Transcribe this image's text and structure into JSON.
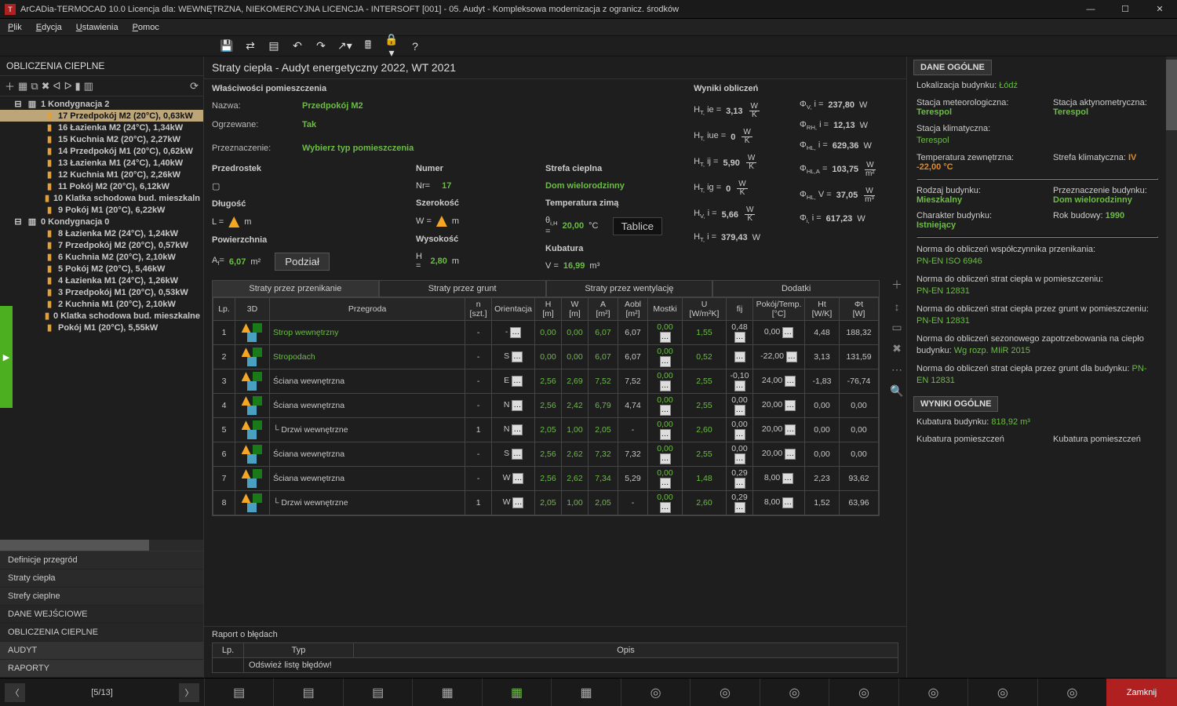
{
  "titlebar": "ArCADia-TERMOCAD 10.0 Licencja dla: WEWNĘTRZNA, NIEKOMERCYJNA LICENCJA - INTERSOFT [001] - 05. Audyt - Kompleksowa modernizacja z ogranicz. środków",
  "menus": [
    "Plik",
    "Edycja",
    "Ustawienia",
    "Pomoc"
  ],
  "left_header": "OBLICZENIA CIEPLNE",
  "tree": [
    {
      "lvl": 1,
      "sel": false,
      "label": "1 Kondygnacja 2"
    },
    {
      "lvl": 2,
      "sel": true,
      "label": "17 Przedpokój M2 (20°C), 0,63kW"
    },
    {
      "lvl": 2,
      "sel": false,
      "label": "16 Łazienka M2 (24°C), 1,34kW"
    },
    {
      "lvl": 2,
      "sel": false,
      "label": "15 Kuchnia M2 (20°C), 2,27kW"
    },
    {
      "lvl": 2,
      "sel": false,
      "label": "14 Przedpokój M1 (20°C), 0,62kW"
    },
    {
      "lvl": 2,
      "sel": false,
      "label": "13 Łazienka M1 (24°C), 1,40kW"
    },
    {
      "lvl": 2,
      "sel": false,
      "label": "12 Kuchnia M1 (20°C), 2,26kW"
    },
    {
      "lvl": 2,
      "sel": false,
      "label": "11 Pokój M2 (20°C), 6,12kW"
    },
    {
      "lvl": 2,
      "sel": false,
      "label": "10 Klatka schodowa bud. mieszkaln"
    },
    {
      "lvl": 2,
      "sel": false,
      "label": "9 Pokój M1 (20°C), 6,22kW"
    },
    {
      "lvl": 1,
      "sel": false,
      "label": "0 Kondygnacja 0"
    },
    {
      "lvl": 2,
      "sel": false,
      "label": "8 Łazienka M2 (24°C), 1,24kW"
    },
    {
      "lvl": 2,
      "sel": false,
      "label": "7 Przedpokój M2 (20°C), 0,57kW"
    },
    {
      "lvl": 2,
      "sel": false,
      "label": "6 Kuchnia M2 (20°C), 2,10kW"
    },
    {
      "lvl": 2,
      "sel": false,
      "label": "5 Pokój M2 (20°C), 5,46kW"
    },
    {
      "lvl": 2,
      "sel": false,
      "label": "4 Łazienka M1 (24°C), 1,26kW"
    },
    {
      "lvl": 2,
      "sel": false,
      "label": "3 Przedpokój M1 (20°C), 0,53kW"
    },
    {
      "lvl": 2,
      "sel": false,
      "label": "2 Kuchnia M1 (20°C), 2,10kW"
    },
    {
      "lvl": 2,
      "sel": false,
      "label": "0 Klatka schodowa bud. mieszkalne"
    },
    {
      "lvl": 2,
      "sel": false,
      "label": "Pokój M1 (20°C), 5,55kW"
    }
  ],
  "side_items": [
    {
      "cls": "light",
      "t": "Definicje przegród"
    },
    {
      "cls": "light",
      "t": "Straty ciepła"
    },
    {
      "cls": "light",
      "t": "Strefy cieplne"
    },
    {
      "cls": "dark",
      "t": "DANE WEJŚCIOWE"
    },
    {
      "cls": "dark",
      "t": "OBLICZENIA CIEPLNE"
    },
    {
      "cls": "",
      "t": "AUDYT"
    },
    {
      "cls": "",
      "t": "RAPORTY"
    }
  ],
  "center_title": "Straty ciepła - Audyt energetyczny 2022, WT 2021",
  "props_header": "Właściwości pomieszczenia",
  "form": {
    "nazwa_l": "Nazwa:",
    "nazwa_v": "Przedpokój M2",
    "ogrz_l": "Ogrzewane:",
    "ogrz_v": "Tak",
    "przez_l": "Przeznaczenie:",
    "przez_v": "Wybierz typ pomieszczenia",
    "przed_l": "Przedrostek",
    "numer_l": "Numer",
    "numer_pre": "Nr=",
    "numer_v": "17",
    "strefa_l": "Strefa cieplna",
    "strefa_v": "Dom wielorodzinny",
    "dlug_l": "Długość",
    "dlug_v": "L =",
    "dlug_u": "m",
    "szer_l": "Szerokość",
    "szer_v": "W =",
    "szer_u": "m",
    "temp_l": "Temperatura zimą",
    "temp_sym": "θ",
    "temp_sub": "i,H",
    "temp_eq": "=",
    "temp_v": "20,00",
    "temp_u": "°C",
    "tablice": "Tablice",
    "pow_l": "Powierzchnia",
    "pow_sym": "A",
    "pow_sub": "f",
    "pow_eq": "=",
    "pow_v": "6,07",
    "pow_u": "m²",
    "podzial": "Podział",
    "wys_l": "Wysokość",
    "wys_sym": "H =",
    "wys_v": "2,80",
    "wys_u": "m",
    "kub_l": "Kubatura",
    "kub_sym": "V =",
    "kub_v": "16,99",
    "kub_u": "m³"
  },
  "results_h": "Wyniki obliczeń",
  "results_left": [
    {
      "sym": "H_T, ie =",
      "v": "3,13",
      "u": "W/K"
    },
    {
      "sym": "H_T, iue =",
      "v": "0",
      "u": "W/K"
    },
    {
      "sym": "H_T, ij =",
      "v": "5,90",
      "u": "W/K"
    },
    {
      "sym": "H_T, ig =",
      "v": "0",
      "u": "W/K"
    },
    {
      "sym": "H_V, i =",
      "v": "5,66",
      "u": "W/K"
    },
    {
      "sym": "H_T, i =",
      "v": "379,43",
      "u": "W"
    }
  ],
  "results_right": [
    {
      "sym": "Φ_V, i =",
      "v": "237,80",
      "u": "W"
    },
    {
      "sym": "Φ_RH, i =",
      "v": "12,13",
      "u": "W"
    },
    {
      "sym": "Φ_HL, i =",
      "v": "629,36",
      "u": "W"
    },
    {
      "sym": "Φ_HL,A =",
      "v": "103,75",
      "u": "W/m²"
    },
    {
      "sym": "Φ_HL, V =",
      "v": "37,05",
      "u": "W/m³"
    },
    {
      "sym": "Φ_i, i =",
      "v": "617,23",
      "u": "W"
    }
  ],
  "tabs": [
    "Straty przez przenikanie",
    "Straty przez grunt",
    "Straty przez wentylację",
    "Dodatki"
  ],
  "grid_headers": [
    "Lp.",
    "3D",
    "Przegroda",
    "n [szt.]",
    "Orientacja",
    "H [m]",
    "W [m]",
    "A [m²]",
    "Aobl [m²]",
    "Mostki",
    "U [W/m²K]",
    "fij",
    "Pokój/Temp. [°C]",
    "Ht [W/K]",
    "Φt [W]"
  ],
  "rows": [
    {
      "lp": "1",
      "name": "Strop wewnętrzny",
      "link": true,
      "n": "-",
      "o": "-",
      "h": "0,00",
      "w": "0,00",
      "a": "6,07",
      "aobl": "6,07",
      "m": "0,00",
      "u": "1,55",
      "f": "0,48",
      "pt": "0,00",
      "ht": "4,48",
      "phi": "188,32"
    },
    {
      "lp": "2",
      "name": "Stropodach",
      "link": true,
      "n": "-",
      "o": "S",
      "h": "0,00",
      "w": "0,00",
      "a": "6,07",
      "aobl": "6,07",
      "m": "0,00",
      "u": "0,52",
      "f": "",
      "pt": "-22,00",
      "ht": "3,13",
      "phi": "131,59"
    },
    {
      "lp": "3",
      "name": "Ściana wewnętrzna",
      "link": false,
      "n": "-",
      "o": "E",
      "h": "2,56",
      "w": "2,69",
      "a": "7,52",
      "aobl": "7,52",
      "m": "0,00",
      "u": "2,55",
      "f": "-0,10",
      "pt": "24,00",
      "ht": "-1,83",
      "phi": "-76,74"
    },
    {
      "lp": "4",
      "name": "Ściana wewnętrzna",
      "link": false,
      "n": "-",
      "o": "N",
      "h": "2,56",
      "w": "2,42",
      "a": "6,79",
      "aobl": "4,74",
      "m": "0,00",
      "u": "2,55",
      "f": "0,00",
      "pt": "20,00",
      "ht": "0,00",
      "phi": "0,00"
    },
    {
      "lp": "5",
      "name": "└ Drzwi wewnętrzne",
      "link": false,
      "n": "1",
      "o": "N",
      "h": "2,05",
      "w": "1,00",
      "a": "2,05",
      "aobl": "-",
      "m": "0,00",
      "u": "2,60",
      "f": "0,00",
      "pt": "20,00",
      "ht": "0,00",
      "phi": "0,00"
    },
    {
      "lp": "6",
      "name": "Ściana wewnętrzna",
      "link": false,
      "n": "-",
      "o": "S",
      "h": "2,56",
      "w": "2,62",
      "a": "7,32",
      "aobl": "7,32",
      "m": "0,00",
      "u": "2,55",
      "f": "0,00",
      "pt": "20,00",
      "ht": "0,00",
      "phi": "0,00"
    },
    {
      "lp": "7",
      "name": "Ściana wewnętrzna",
      "link": false,
      "n": "-",
      "o": "W",
      "h": "2,56",
      "w": "2,62",
      "a": "7,34",
      "aobl": "5,29",
      "m": "0,00",
      "u": "1,48",
      "f": "0,29",
      "pt": "8,00",
      "ht": "2,23",
      "phi": "93,62"
    },
    {
      "lp": "8",
      "name": "└ Drzwi wewnętrzne",
      "link": false,
      "n": "1",
      "o": "W",
      "h": "2,05",
      "w": "1,00",
      "a": "2,05",
      "aobl": "-",
      "m": "0,00",
      "u": "2,60",
      "f": "0,29",
      "pt": "8,00",
      "ht": "1,52",
      "phi": "63,96"
    }
  ],
  "right_sections": {
    "h1": "DANE OGÓLNE",
    "loc_l": "Lokalizacja budynku:",
    "loc_v": "Łódź",
    "meteo_l": "Stacja meteorologiczna:",
    "meteo_v": "Terespol",
    "akt_l": "Stacja aktynometryczna:",
    "akt_v": "Terespol",
    "klim_l": "Stacja klimatyczna:",
    "klim_v": "Terespol",
    "tzew_l": "Temperatura zewnętrzna:",
    "tzew_v": "-22,00 °C",
    "skl_l": "Strefa klimatyczna:",
    "skl_v": "IV",
    "rodz_l": "Rodzaj budynku:",
    "rodz_v": "Mieszkalny",
    "przezn_l": "Przeznaczenie budynku:",
    "przezn_v": "Dom wielorodzinny",
    "char_l": "Charakter budynku:",
    "char_v": "Istniejący",
    "rok_l": "Rok budowy:",
    "rok_v": "1990",
    "n1_l": "Norma do obliczeń współczynnika przenikania:",
    "n1_v": "PN-EN ISO 6946",
    "n2_l": "Norma do obliczeń strat ciepła w pomieszczeniu:",
    "n2_v": "PN-EN 12831",
    "n3_l": "Norma do obliczeń strat ciepła przez grunt w pomieszczeniu:",
    "n3_v": "PN-EN 12831",
    "n4_l": "Norma do obliczeń sezonowego zapotrzebowania na ciepło budynku:",
    "n4_v": "Wg rozp. MIiR 2015",
    "n5_l": "Norma do obliczeń strat ciepła przez grunt dla budynku:",
    "n5_v": "PN-EN 12831",
    "h2": "WYNIKI OGÓLNE",
    "kub_l": "Kubatura budynku:",
    "kub_v": "818,92 m³",
    "kp1": "Kubatura pomieszczeń",
    "kp2": "Kubatura pomieszczeń"
  },
  "report_h": "Raport o błędach",
  "err_headers": [
    "Lp.",
    "Typ",
    "Opis"
  ],
  "err_row": "Odśwież listę błędów!",
  "status_counter": "[5/13]",
  "close": "Zamknij"
}
